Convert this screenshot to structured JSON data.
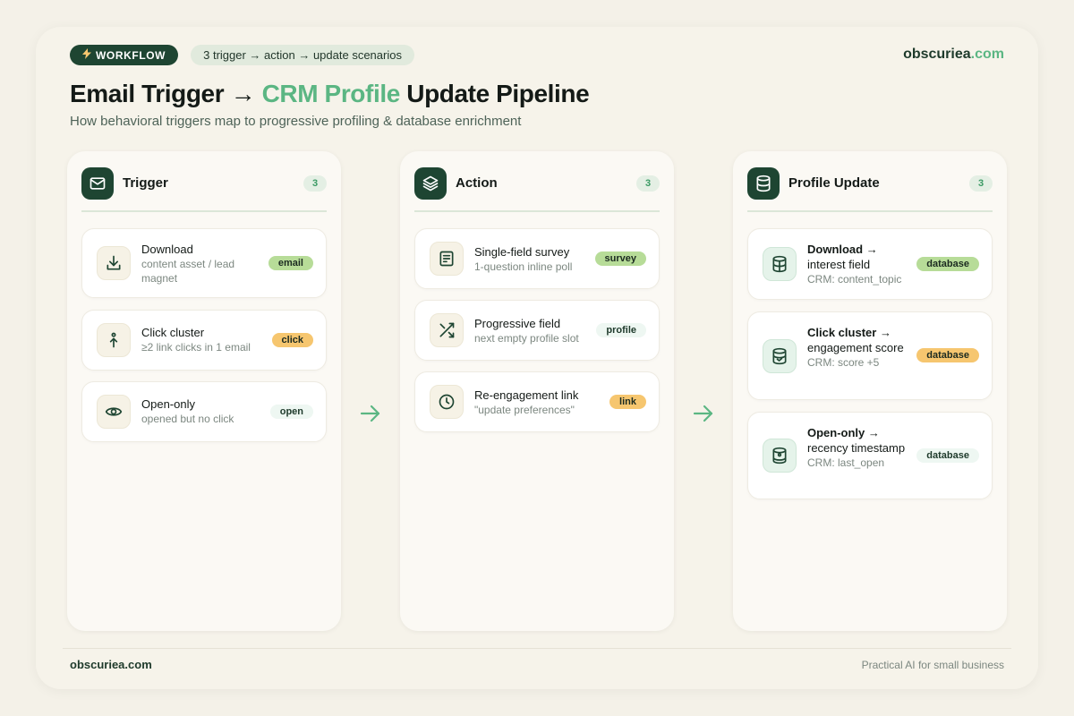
{
  "header": {
    "badge_label": "WORKFLOW",
    "badge_icon": "lightning-icon",
    "scenario_label": "3 trigger → action → update scenarios",
    "brand_name": "obscuriea",
    "brand_tld": ".com",
    "title_part1": "Email Trigger",
    "title_arrow": "→",
    "title_accent": "CRM Profile",
    "title_part2": "Update Pipeline",
    "subtitle": "How behavioral triggers map to progressive profiling & database enrichment"
  },
  "colors": {
    "dark_green": "#1e4532",
    "accent_green": "#5bb683",
    "tag_green": "#b7dc98",
    "tag_orange": "#f6c66f",
    "tag_mint": "#eef7f2",
    "background": "#f4f1e8"
  },
  "columns": [
    {
      "title": "Trigger",
      "count": "3",
      "icon": "mail-icon",
      "cards": [
        {
          "title": "Download",
          "sub": "content asset / lead magnet",
          "tag": "email",
          "icon": "download-icon"
        },
        {
          "title": "Click cluster",
          "sub": "≥2 link clicks in 1 email",
          "tag": "click",
          "icon": "click-icon"
        },
        {
          "title": "Open-only",
          "sub": "opened but no click",
          "tag": "open",
          "icon": "eye-icon"
        }
      ]
    },
    {
      "title": "Action",
      "count": "3",
      "icon": "layers-icon",
      "cards": [
        {
          "title": "Single-field survey",
          "sub": "1-question inline poll",
          "tag": "survey",
          "icon": "survey-icon"
        },
        {
          "title": "Progressive field",
          "sub": "next empty profile slot",
          "tag": "profile",
          "icon": "shuffle-icon"
        },
        {
          "title": "Re-engagement link",
          "sub": "\"update preferences\"",
          "tag": "link",
          "icon": "clock-icon"
        }
      ]
    },
    {
      "title": "Profile Update",
      "count": "3",
      "icon": "database-icon",
      "cards": [
        {
          "title_bold": "Download",
          "title_arrow": "→",
          "title_rest": "interest field",
          "sub": "CRM: content_topic",
          "tag": "database",
          "icon": "database-grid-icon"
        },
        {
          "title_bold": "Click cluster",
          "title_arrow": "→",
          "title_rest": "engagement score",
          "sub": "CRM: score +5",
          "tag": "database",
          "icon": "database-check-icon"
        },
        {
          "title_bold": "Open-only",
          "title_arrow": "→",
          "title_rest": "recency timestamp",
          "sub": "CRM: last_open",
          "tag": "database",
          "icon": "database-lock-icon"
        }
      ]
    }
  ],
  "footer": {
    "brand": "obscuriea.com",
    "tagline": "Practical AI for small business"
  }
}
